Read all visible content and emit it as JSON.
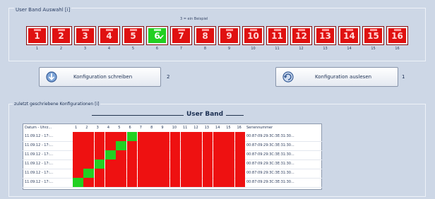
{
  "group1": {
    "title": "User Band Auswahl [i]",
    "hint": "3 = ein Beispiel",
    "bands": [
      {
        "label": "1",
        "index": "1",
        "active": false
      },
      {
        "label": "2",
        "index": "2",
        "active": false
      },
      {
        "label": "3",
        "index": "3",
        "active": false
      },
      {
        "label": "4",
        "index": "4",
        "active": false
      },
      {
        "label": "5",
        "index": "5",
        "active": false
      },
      {
        "label": "6",
        "index": "6",
        "active": true
      },
      {
        "label": "7",
        "index": "7",
        "active": false
      },
      {
        "label": "8",
        "index": "8",
        "active": false
      },
      {
        "label": "9",
        "index": "9",
        "active": false
      },
      {
        "label": "10",
        "index": "10",
        "active": false
      },
      {
        "label": "11",
        "index": "11",
        "active": false
      },
      {
        "label": "12",
        "index": "12",
        "active": false
      },
      {
        "label": "13",
        "index": "13",
        "active": false
      },
      {
        "label": "14",
        "index": "14",
        "active": false
      },
      {
        "label": "15",
        "index": "15",
        "active": false
      },
      {
        "label": "16",
        "index": "16",
        "active": false
      }
    ],
    "check_glyph": "✔"
  },
  "actions": {
    "write_label": "Konfiguration schreiben",
    "write_indicator": "2",
    "read_label": "Konfiguration auslesen",
    "read_indicator": "1"
  },
  "group2": {
    "title": "zuletzt geschriebene Konfigurationen [i]",
    "user_band_title": "User Band",
    "columns": {
      "date": "Datum - Uhrz...",
      "bands": [
        "1",
        "2",
        "3",
        "4",
        "5",
        "6",
        "7",
        "8",
        "9",
        "10",
        "11",
        "12",
        "13",
        "14",
        "15",
        "16"
      ],
      "serial": "Seriennummer"
    },
    "rows": [
      {
        "date": "11.09.12 - 17:...",
        "active_band": 6,
        "serial": "00:87:09:29:3C:3E:31:30..."
      },
      {
        "date": "11.09.12 - 17:...",
        "active_band": 5,
        "serial": "00:87:09:29:3C:3E:31:30..."
      },
      {
        "date": "11.09.12 - 17:...",
        "active_band": 4,
        "serial": "00:87:09:29:3C:3E:31:30..."
      },
      {
        "date": "11.09.12 - 17:...",
        "active_band": 3,
        "serial": "00:87:09:29:3C:3E:31:30..."
      },
      {
        "date": "11.09.12 - 17:...",
        "active_band": 2,
        "serial": "00:87:09:29:3C:3E:31:30..."
      },
      {
        "date": "11.09.12 - 17:...",
        "active_band": 1,
        "serial": "00:87:09:29:3C:3E:31:30..."
      }
    ]
  },
  "colors": {
    "band_off": "#e01111",
    "band_on": "#22d022",
    "background": "#cdd7e6"
  }
}
